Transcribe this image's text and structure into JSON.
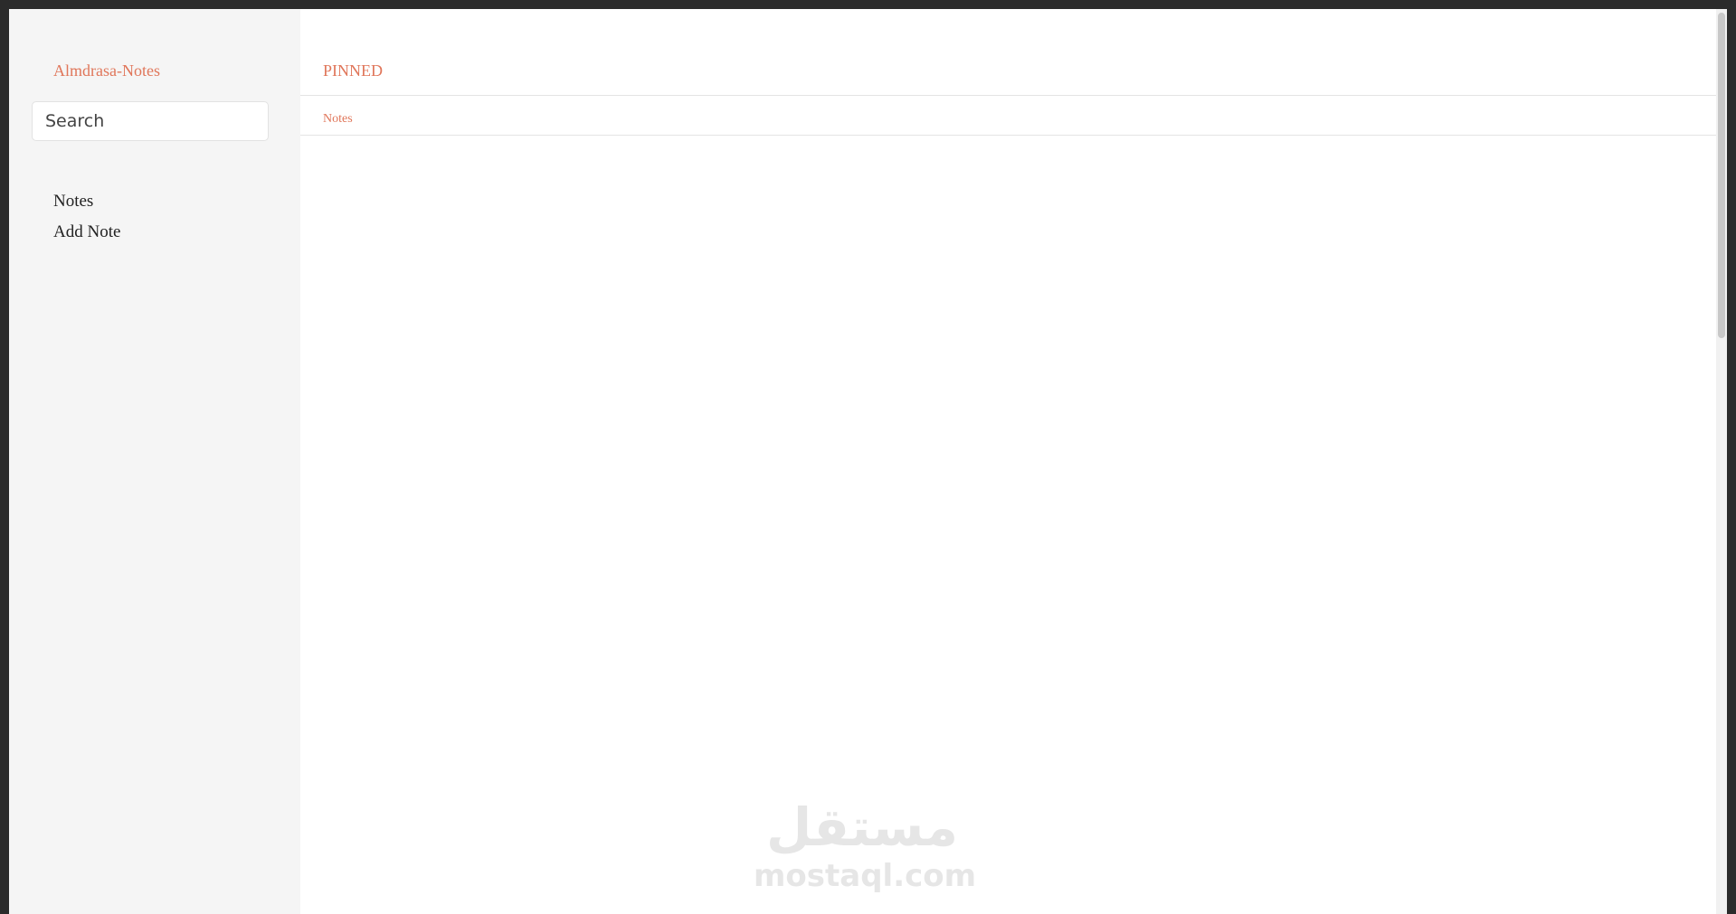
{
  "sidebar": {
    "brand": "Almdrasa-Notes",
    "search": {
      "placeholder": "Search",
      "value": ""
    },
    "nav": [
      {
        "label": "Notes"
      },
      {
        "label": "Add Note"
      }
    ]
  },
  "main": {
    "pinned_label": "PINNED",
    "notes_label": "Notes"
  },
  "watermark": {
    "arabic": "مستقل",
    "latin": "mostaql.com"
  },
  "colors": {
    "accent": "#e0765a",
    "sidebar_bg": "#f5f5f5",
    "frame": "#2b2b2b"
  }
}
